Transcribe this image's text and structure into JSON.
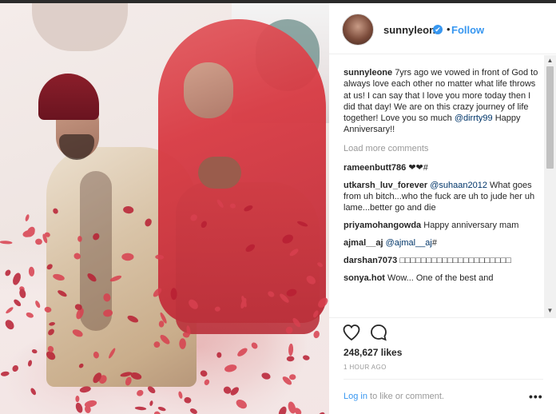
{
  "post": {
    "username": "sunnyleone",
    "verified_badge": "✔",
    "separator": "•",
    "follow_label": "Follow",
    "caption_text": "7yrs ago we vowed in front of God to always love each other no matter what life throws at us! I can say that I love you more today then I did that day! We are on this crazy journey of life together! Love you so much ",
    "caption_mention": "@dirrty99",
    "caption_end": " Happy Anniversary!!",
    "load_more": "Load more comments",
    "comments": [
      {
        "user": "rameenbutt786",
        "text": "❤❤#",
        "mention": ""
      },
      {
        "user": "utkarsh_luv_forever",
        "text": " What goes from uh bitch...who the fuck are uh to jude her uh lame...better go and die",
        "mention": "@suhaan2012"
      },
      {
        "user": "priyamohangowda",
        "text": " Happy anniversary mam",
        "mention": ""
      },
      {
        "user": "ajmal__aj",
        "text": "#",
        "mention": "@ajmal__aj"
      },
      {
        "user": "darshan7073",
        "text": " □□□□□□□□□□□□□□□□□□□□□",
        "mention": ""
      },
      {
        "user": "sonya.hot",
        "text": " Wow... One of the best and",
        "mention": ""
      }
    ],
    "likes": "248,627 likes",
    "time_ago": "1 HOUR AGO",
    "login_label": "Log in",
    "login_suffix": " to like or comment.",
    "more_label": "•••"
  },
  "icons": {
    "heart": "heart-icon",
    "comment": "comment-icon",
    "more": "more-options-icon",
    "verified": "verified-badge-icon"
  },
  "colors": {
    "link_blue": "#3897f0",
    "mention_blue": "#003569",
    "muted_gray": "#999999",
    "text": "#262626"
  }
}
